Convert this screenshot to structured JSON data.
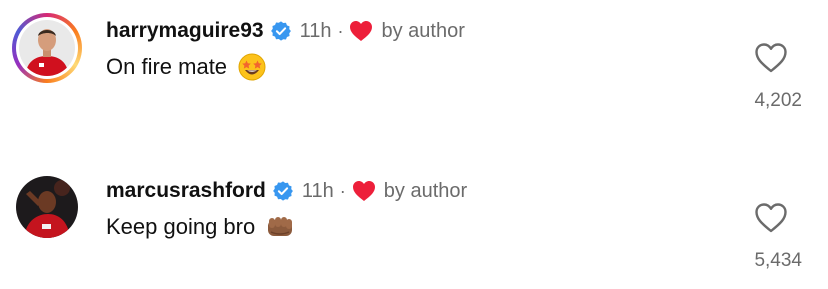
{
  "comments": [
    {
      "username": "harrymaguire93",
      "time": "11h",
      "separator": "·",
      "author_like_label": "by author",
      "text": "On fire mate",
      "emoji_icon": "star-struck-emoji",
      "like_count": "4,202",
      "has_story_ring": true
    },
    {
      "username": "marcusrashford",
      "time": "11h",
      "separator": "·",
      "author_like_label": "by author",
      "text": "Keep going bro",
      "emoji_icon": "oncoming-fist-emoji",
      "like_count": "5,434",
      "has_story_ring": false
    }
  ],
  "colors": {
    "verified_blue": "#3897f0",
    "heart_red": "#ed1f3a",
    "secondary_text": "#6b6b6b"
  }
}
